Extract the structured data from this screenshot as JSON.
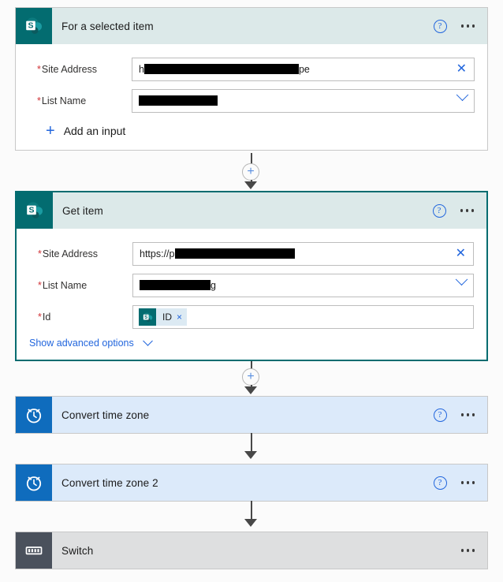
{
  "flow": {
    "cards": [
      {
        "id": "for-a-selected-item",
        "title": "For a selected item",
        "icon": "sharepoint-icon",
        "connector": "SharePoint",
        "selected": false,
        "has_help": true,
        "help_label": "?",
        "fields": [
          {
            "label": "Site Address",
            "required_marker": "*",
            "value_prefix": "h",
            "value_suffix": "pe",
            "redacted": true,
            "control": "clear",
            "control_icon": "close-icon"
          },
          {
            "label": "List Name",
            "required_marker": "*",
            "value_prefix": "",
            "value_suffix": "",
            "redacted": true,
            "control": "dropdown",
            "control_icon": "chevron-down-icon"
          }
        ],
        "add_input_label": "Add an input",
        "add_input_icon": "plus-icon"
      },
      {
        "id": "get-item",
        "title": "Get item",
        "icon": "sharepoint-icon",
        "connector": "SharePoint",
        "selected": true,
        "has_help": true,
        "help_label": "?",
        "fields": [
          {
            "label": "Site Address",
            "required_marker": "*",
            "value_prefix": "https://p",
            "value_suffix": "",
            "redacted": true,
            "control": "clear",
            "control_icon": "close-icon"
          },
          {
            "label": "List Name",
            "required_marker": "*",
            "value_prefix": "",
            "value_suffix": "g",
            "redacted": true,
            "control": "dropdown",
            "control_icon": "chevron-down-icon"
          },
          {
            "label": "Id",
            "required_marker": "*",
            "token": {
              "label": "ID",
              "icon": "sharepoint-icon",
              "remove_label": "×"
            },
            "control": "token"
          }
        ],
        "advanced_label": "Show advanced options",
        "advanced_icon": "chevron-down-icon"
      },
      {
        "id": "convert-time-zone",
        "title": "Convert time zone",
        "icon": "clock-icon",
        "connector": "Date Time",
        "selected": false,
        "has_help": true,
        "help_label": "?",
        "collapsed": true
      },
      {
        "id": "convert-time-zone-2",
        "title": "Convert time zone 2",
        "icon": "clock-icon",
        "connector": "Date Time",
        "selected": false,
        "has_help": true,
        "help_label": "?",
        "collapsed": true
      },
      {
        "id": "switch",
        "title": "Switch",
        "icon": "switch-icon",
        "connector": "Control",
        "selected": false,
        "has_help": false,
        "collapsed": true
      }
    ],
    "connectors": [
      {
        "id": "connector-1",
        "type": "insert",
        "insert_label": "+"
      },
      {
        "id": "connector-2",
        "type": "insert",
        "insert_label": "+"
      },
      {
        "id": "connector-3",
        "type": "arrow"
      },
      {
        "id": "connector-4",
        "type": "arrow"
      }
    ],
    "menu_label": "More commands"
  },
  "colors": {
    "sharepoint_teal": "#036c70",
    "sharepoint_header": "#dce9e9",
    "clock_blue": "#0f6cbd",
    "clock_header": "#dceafa",
    "switch_slate": "#4a515c",
    "switch_header": "#dedfe0",
    "link_blue": "#2266dd",
    "required_red": "#d13438",
    "canvas": "#fbfbfb"
  }
}
